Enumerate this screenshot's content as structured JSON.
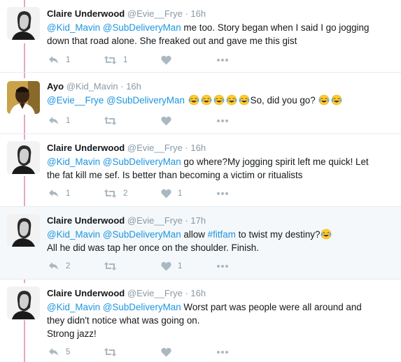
{
  "colors": {
    "link": "#1b95e0",
    "thread_line": "#e6a6c5",
    "muted": "#8899a6",
    "highlight_bg": "#f5f8fa"
  },
  "tweets": [
    {
      "name": "Claire Underwood",
      "handle": "@Evie__Frye",
      "time": "16h",
      "mention1": "@Kid_Mavin",
      "mention2": "@SubDeliveryMan",
      "line1_rest": " me too. Story began when I said I go jogging",
      "line2": "down that road alone. She freaked out and gave me this gist",
      "reply_count": "1",
      "retweet_count": "1",
      "like_count": ""
    },
    {
      "name": "Ayo",
      "handle": "@Kid_Mavin",
      "time": "16h",
      "mention1": "@Evie__Frye",
      "mention2": "@SubDeliveryMan",
      "text_after_emojis": "So, did you go?",
      "reply_count": "1",
      "retweet_count": "",
      "like_count": ""
    },
    {
      "name": "Claire Underwood",
      "handle": "@Evie__Frye",
      "time": "16h",
      "mention1": "@Kid_Mavin",
      "mention2": "@SubDeliveryMan",
      "line1_rest": " go where?My jogging spirit left me quick! Let",
      "line2": "the fat kill me sef. Is better than becoming a victim or ritualists",
      "reply_count": "1",
      "retweet_count": "2",
      "like_count": "1"
    },
    {
      "name": "Claire Underwood",
      "handle": "@Evie__Frye",
      "time": "17h",
      "mention1": "@Kid_Mavin",
      "mention2": "@SubDeliveryMan",
      "line1_mid": " allow ",
      "hashtag": "#fitfam",
      "line1_end": " to twist my destiny?",
      "line2": "All he did was tap her once on the shoulder. Finish.",
      "reply_count": "2",
      "retweet_count": "",
      "like_count": "1"
    },
    {
      "name": "Claire Underwood",
      "handle": "@Evie__Frye",
      "time": "16h",
      "mention1": "@Kid_Mavin",
      "mention2": "@SubDeliveryMan",
      "line1_rest": " Worst part was people were all around and",
      "line2": "they didn't notice what was going on.",
      "line3": "Strong jazz!",
      "reply_count": "5",
      "retweet_count": "",
      "like_count": ""
    }
  ]
}
